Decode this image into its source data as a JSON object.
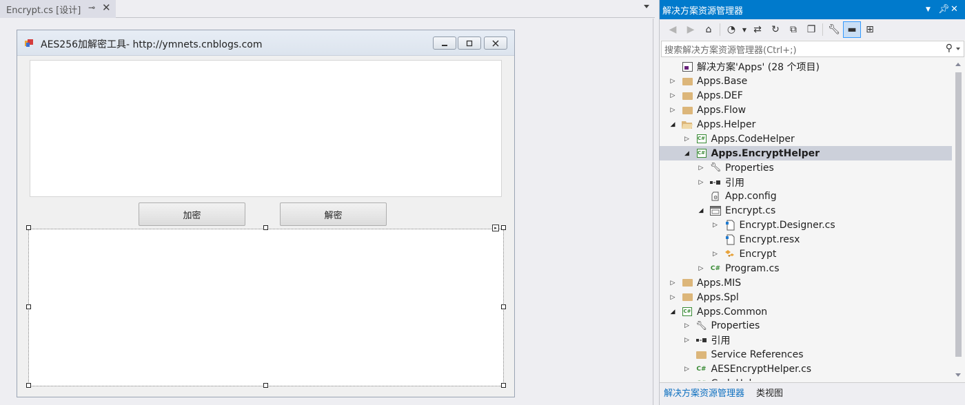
{
  "doc_tab": {
    "title": "Encrypt.cs [设计]",
    "pin": "⊸",
    "close": "✕"
  },
  "form": {
    "title": "AES256加解密工具- http://ymnets.cnblogs.com",
    "encrypt_label": "加密",
    "decrypt_label": "解密"
  },
  "solution_explorer": {
    "title": "解决方案资源管理器",
    "search_placeholder": "搜索解决方案资源管理器(Ctrl+;)",
    "tabs": [
      "解决方案资源管理器",
      "类视图"
    ],
    "tree": [
      {
        "label": "解决方案'Apps' (28 个项目)",
        "level": 0,
        "expander": "",
        "icon": "solution-icon"
      },
      {
        "label": "Apps.Base",
        "level": 0,
        "expander": "collapsed",
        "icon": "folder-icon"
      },
      {
        "label": "Apps.DEF",
        "level": 0,
        "expander": "collapsed",
        "icon": "folder-icon"
      },
      {
        "label": "Apps.Flow",
        "level": 0,
        "expander": "collapsed",
        "icon": "folder-icon"
      },
      {
        "label": "Apps.Helper",
        "level": 0,
        "expander": "expanded",
        "icon": "folder-open-icon"
      },
      {
        "label": "Apps.CodeHelper",
        "level": 1,
        "expander": "collapsed",
        "icon": "csharp-project-icon"
      },
      {
        "label": "Apps.EncryptHelper",
        "level": 1,
        "expander": "expanded",
        "icon": "csharp-project-icon",
        "selected": true
      },
      {
        "label": "Properties",
        "level": 2,
        "expander": "collapsed",
        "icon": "wrench-icon"
      },
      {
        "label": "引用",
        "level": 2,
        "expander": "collapsed",
        "icon": "references-icon"
      },
      {
        "label": "App.config",
        "level": 2,
        "expander": "",
        "icon": "config-icon"
      },
      {
        "label": "Encrypt.cs",
        "level": 2,
        "expander": "expanded",
        "icon": "form-icon"
      },
      {
        "label": "Encrypt.Designer.cs",
        "level": 3,
        "expander": "collapsed",
        "icon": "designer-file-icon"
      },
      {
        "label": "Encrypt.resx",
        "level": 3,
        "expander": "",
        "icon": "resx-icon"
      },
      {
        "label": "Encrypt",
        "level": 3,
        "expander": "collapsed",
        "icon": "class-icon"
      },
      {
        "label": "Program.cs",
        "level": 2,
        "expander": "collapsed",
        "icon": "csharp-file-icon"
      },
      {
        "label": "Apps.MIS",
        "level": 0,
        "expander": "collapsed",
        "icon": "folder-icon"
      },
      {
        "label": "Apps.Spl",
        "level": 0,
        "expander": "collapsed",
        "icon": "folder-icon"
      },
      {
        "label": "Apps.Common",
        "level": 0,
        "expander": "expanded",
        "icon": "csharp-project-icon"
      },
      {
        "label": "Properties",
        "level": 1,
        "expander": "collapsed",
        "icon": "wrench-icon"
      },
      {
        "label": "引用",
        "level": 1,
        "expander": "collapsed",
        "icon": "references-icon"
      },
      {
        "label": "Service References",
        "level": 1,
        "expander": "",
        "icon": "folder-icon"
      },
      {
        "label": "AESEncryptHelper.cs",
        "level": 1,
        "expander": "collapsed",
        "icon": "csharp-file-icon"
      },
      {
        "label": "CodeHelper.cs",
        "level": 1,
        "expander": "collapsed",
        "icon": "csharp-file-icon"
      }
    ]
  },
  "colors": {
    "accent": "#007acc",
    "selection": "#ccd0da",
    "folder": "#dcb67a",
    "csharp": "#388a34"
  }
}
